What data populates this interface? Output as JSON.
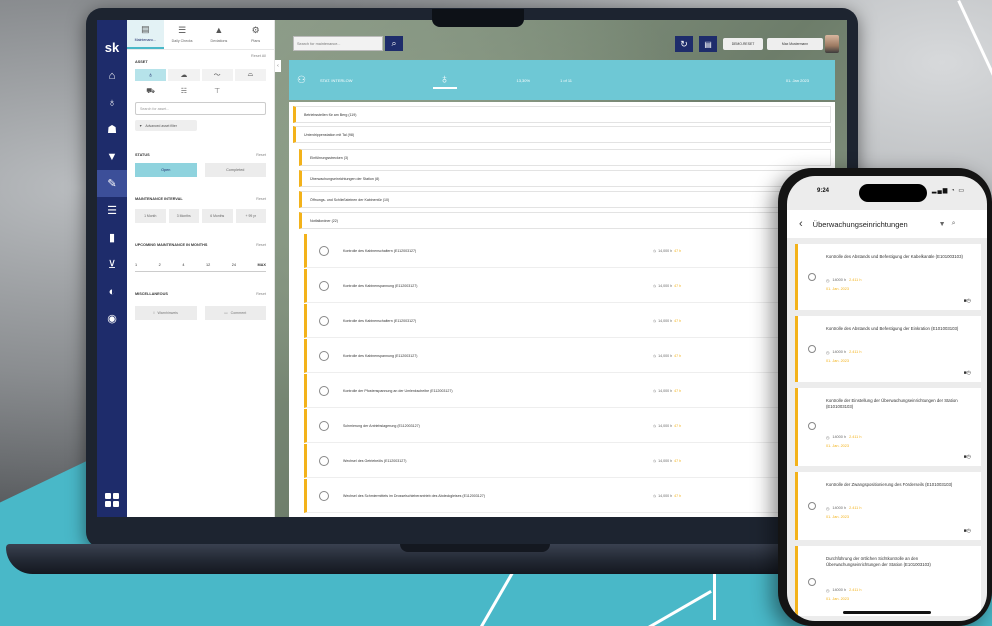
{
  "app": {
    "logo": "sk",
    "nav_icons": [
      "home-icon",
      "bulb-icon",
      "tower-icon",
      "funnel-icon",
      "wrench-icon",
      "list-icon",
      "document-icon",
      "cart-icon",
      "gauge-icon",
      "settings-icon"
    ]
  },
  "panel": {
    "tabs": [
      {
        "label": "Maintenanc...",
        "icon": "clipboard-icon",
        "glyph": "▤"
      },
      {
        "label": "Daily Checks",
        "icon": "checklist-icon",
        "glyph": "☰"
      },
      {
        "label": "Deviations",
        "icon": "warning-icon",
        "glyph": "▲"
      },
      {
        "label": "Plans",
        "icon": "gear-icon",
        "glyph": "⚙"
      }
    ],
    "reset_all": "Reset All",
    "assets_label": "ASSET",
    "search_placeholder": "Search for asset...",
    "advanced_label": "Advanced asset filter",
    "status_label": "STATUS",
    "status_options": [
      "Open",
      "Completed"
    ],
    "interval_label": "MAINTENANCE INTERVAL",
    "intervals": [
      "1 Month",
      "3 Months",
      "6 Months",
      "+ 99 yr"
    ],
    "upcoming_label": "UPCOMING MAINTENANCE IN MONTHS",
    "months": [
      "1",
      "2",
      "4",
      "12",
      "24",
      "MAX"
    ],
    "selected_month": "MAX",
    "misc_label": "MISCELLANEOUS",
    "misc_options": [
      "Warnhinweis",
      "Comment"
    ],
    "reset": "Reset"
  },
  "topbar": {
    "search_placeholder": "Search for maintenance...",
    "user_id": "DEMO-RESET",
    "user_name": "Max Mustermann"
  },
  "station": {
    "name": "STAT. INTERLOW",
    "percent": "13,30%",
    "count": "1 of 11",
    "date": "01. Jan 2023"
  },
  "tree": [
    "Betriebsstellen für am Berg (119)",
    "Unterdrippenstation mit Tal (98)",
    "Einführungsstrecken (3)",
    "Überwachungseinrichtungen der Station (8)",
    "Öffnungs- und Schließsteinen der Kabinentür (10)",
    "Notfallordner (22)"
  ],
  "tasks": [
    {
      "name": "Kontrolle des Kabinenschaltern (E112003127)",
      "pct": "14,000 h",
      "yellow": "47 h",
      "due": "01 Jan"
    },
    {
      "name": "Kontrolle des Kabinenspannung (E112003127)",
      "pct": "14,000 h",
      "yellow": "47 h",
      "due": "01 Jan"
    },
    {
      "name": "Kontrolle des Kabinenschaltern (E112003127)",
      "pct": "14,000 h",
      "yellow": "47 h",
      "due": "01 Jan"
    },
    {
      "name": "Kontrolle des Kabinenspannung (E112003127)",
      "pct": "14,000 h",
      "yellow": "47 h",
      "due": "01 Jan"
    },
    {
      "name": "Kontrolle der Pfostenspannung an der Umlenkscheibe (E112003127)",
      "pct": "14,000 h",
      "yellow": "47 h",
      "due": "01 Jan"
    },
    {
      "name": "Schmierung der Antriebslagerung (E112003127)",
      "pct": "14,000 h",
      "yellow": "47 h",
      "due": "01 Jan"
    },
    {
      "name": "Wechsel des Getriebeöls (E112003127)",
      "pct": "14,000 h",
      "yellow": "47 h",
      "due": "01 Jan"
    },
    {
      "name": "Wechsel des Schmiermittels im Drosselschieberantrieb des Abdeckgleises (E112003127)",
      "pct": "14,000 h",
      "yellow": "47 h",
      "due": "01 Jan"
    }
  ],
  "phone": {
    "time": "9:24",
    "status": "▂▄▆ ◔ ▭",
    "title": "Überwachungseinrichtungen",
    "cards": [
      {
        "text": "Kontrolle des Abstands und Befestigung der Kabelkanäle (E101003103)",
        "meta": "14000 h",
        "yellow": "2.411 h",
        "due": "01. Jan. 2023"
      },
      {
        "text": "Kontrolle des Abstands und Befestigung der Einkration (E101003103)",
        "meta": "14000 h",
        "yellow": "2.411 h",
        "due": "01. Jan. 2023"
      },
      {
        "text": "Kontrolle der Einstellung der Überwachungseinrichtungen der Station (E101003103)",
        "meta": "14000 h",
        "yellow": "2.411 h",
        "due": "01. Jan. 2023"
      },
      {
        "text": "Kontrolle der Zwangspositionierung des Förderseils (E101003103)",
        "meta": "14000 h",
        "yellow": "2.411 h",
        "due": "01. Jan. 2023"
      },
      {
        "text": "Durchführung der örtlichen Sichtkontrolle an den Überwachungseinrichtungen der Station (E101003103)",
        "meta": "14000 h",
        "yellow": "2.411 h",
        "due": "01. Jan. 2023"
      }
    ]
  },
  "colors": {
    "navy": "#1e2c6b",
    "teal": "#49b8c8",
    "accent": "#f3b21a"
  }
}
